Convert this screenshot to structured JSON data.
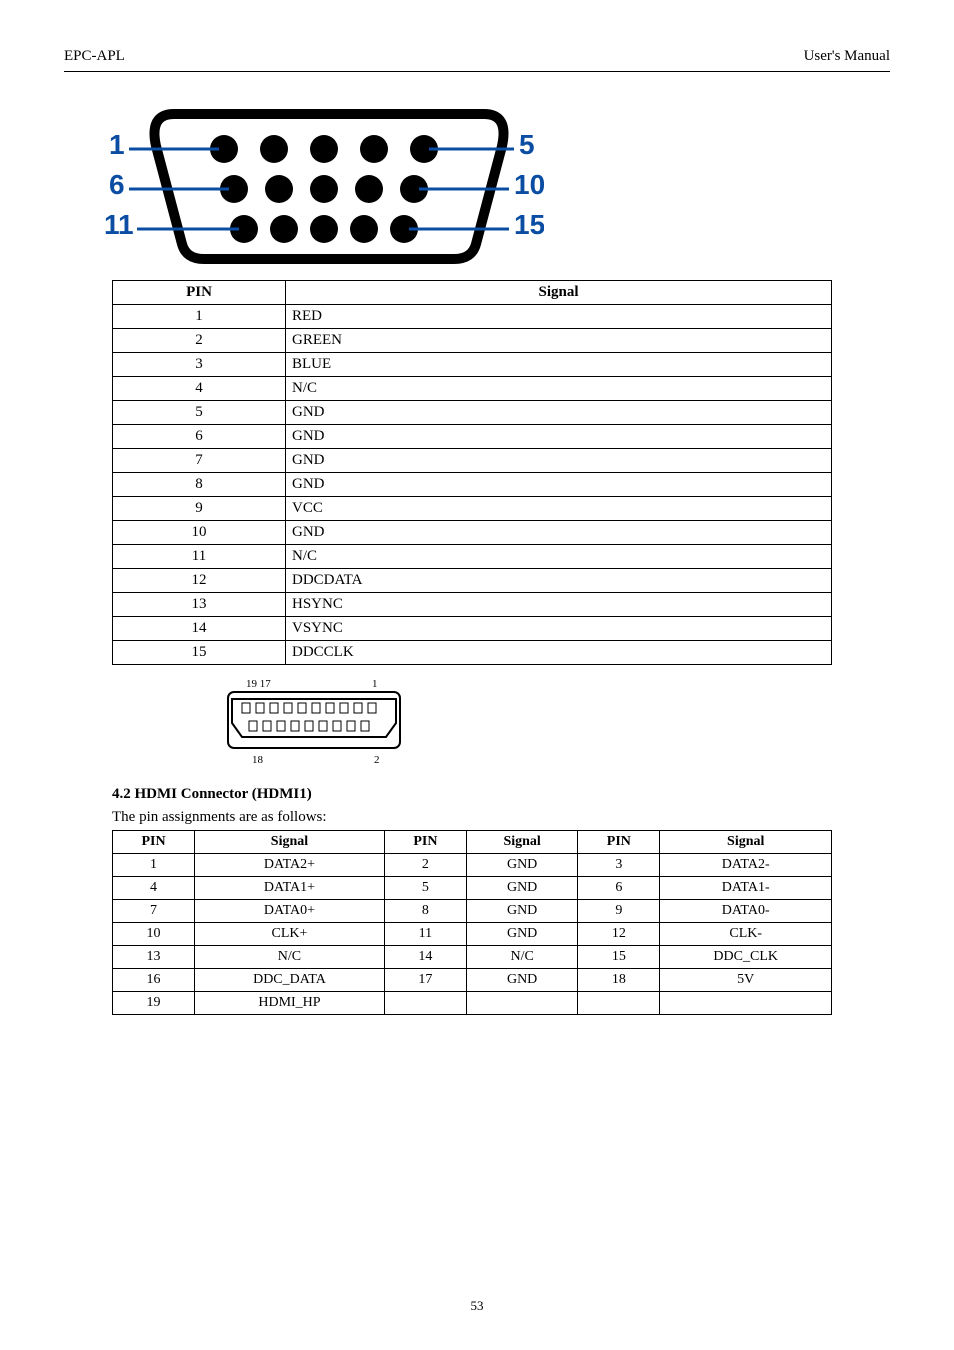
{
  "header": {
    "left": "EPC-APL",
    "right": "User's Manual"
  },
  "vga_table": {
    "col1": "PIN",
    "col2": "Signal",
    "rows": [
      [
        "1",
        "RED"
      ],
      [
        "2",
        "GREEN"
      ],
      [
        "3",
        "BLUE"
      ],
      [
        "4",
        "N/C"
      ],
      [
        "5",
        "GND"
      ],
      [
        "6",
        "GND"
      ],
      [
        "7",
        "GND"
      ],
      [
        "8",
        "GND"
      ],
      [
        "9",
        "VCC"
      ],
      [
        "10",
        "GND"
      ],
      [
        "11",
        "N/C"
      ],
      [
        "12",
        "DDCDATA"
      ],
      [
        "13",
        "HSYNC"
      ],
      [
        "14",
        "VSYNC"
      ],
      [
        "15",
        "DDCCLK"
      ]
    ]
  },
  "hdmi_section": {
    "title": "4.2 HDMI Connector (HDMI1)",
    "caption": "The pin assignments are as follows:",
    "headers": [
      "PIN",
      "Signal",
      "PIN",
      "Signal",
      "PIN",
      "Signal"
    ],
    "rows": [
      [
        "1",
        "DATA2+",
        "2",
        "GND",
        "3",
        "DATA2-"
      ],
      [
        "4",
        "DATA1+",
        "5",
        "GND",
        "6",
        "DATA1-"
      ],
      [
        "7",
        "DATA0+",
        "8",
        "GND",
        "9",
        "DATA0-"
      ],
      [
        "10",
        "CLK+",
        "11",
        "GND",
        "12",
        "CLK-"
      ],
      [
        "13",
        "N/C",
        "14",
        "N/C",
        "15",
        "DDC_CLK"
      ],
      [
        "16",
        "DDC_DATA",
        "17",
        "GND",
        "18",
        "5V"
      ],
      [
        "19",
        "HDMI_HP",
        "",
        "",
        " ",
        " "
      ]
    ]
  },
  "page_number": "53"
}
